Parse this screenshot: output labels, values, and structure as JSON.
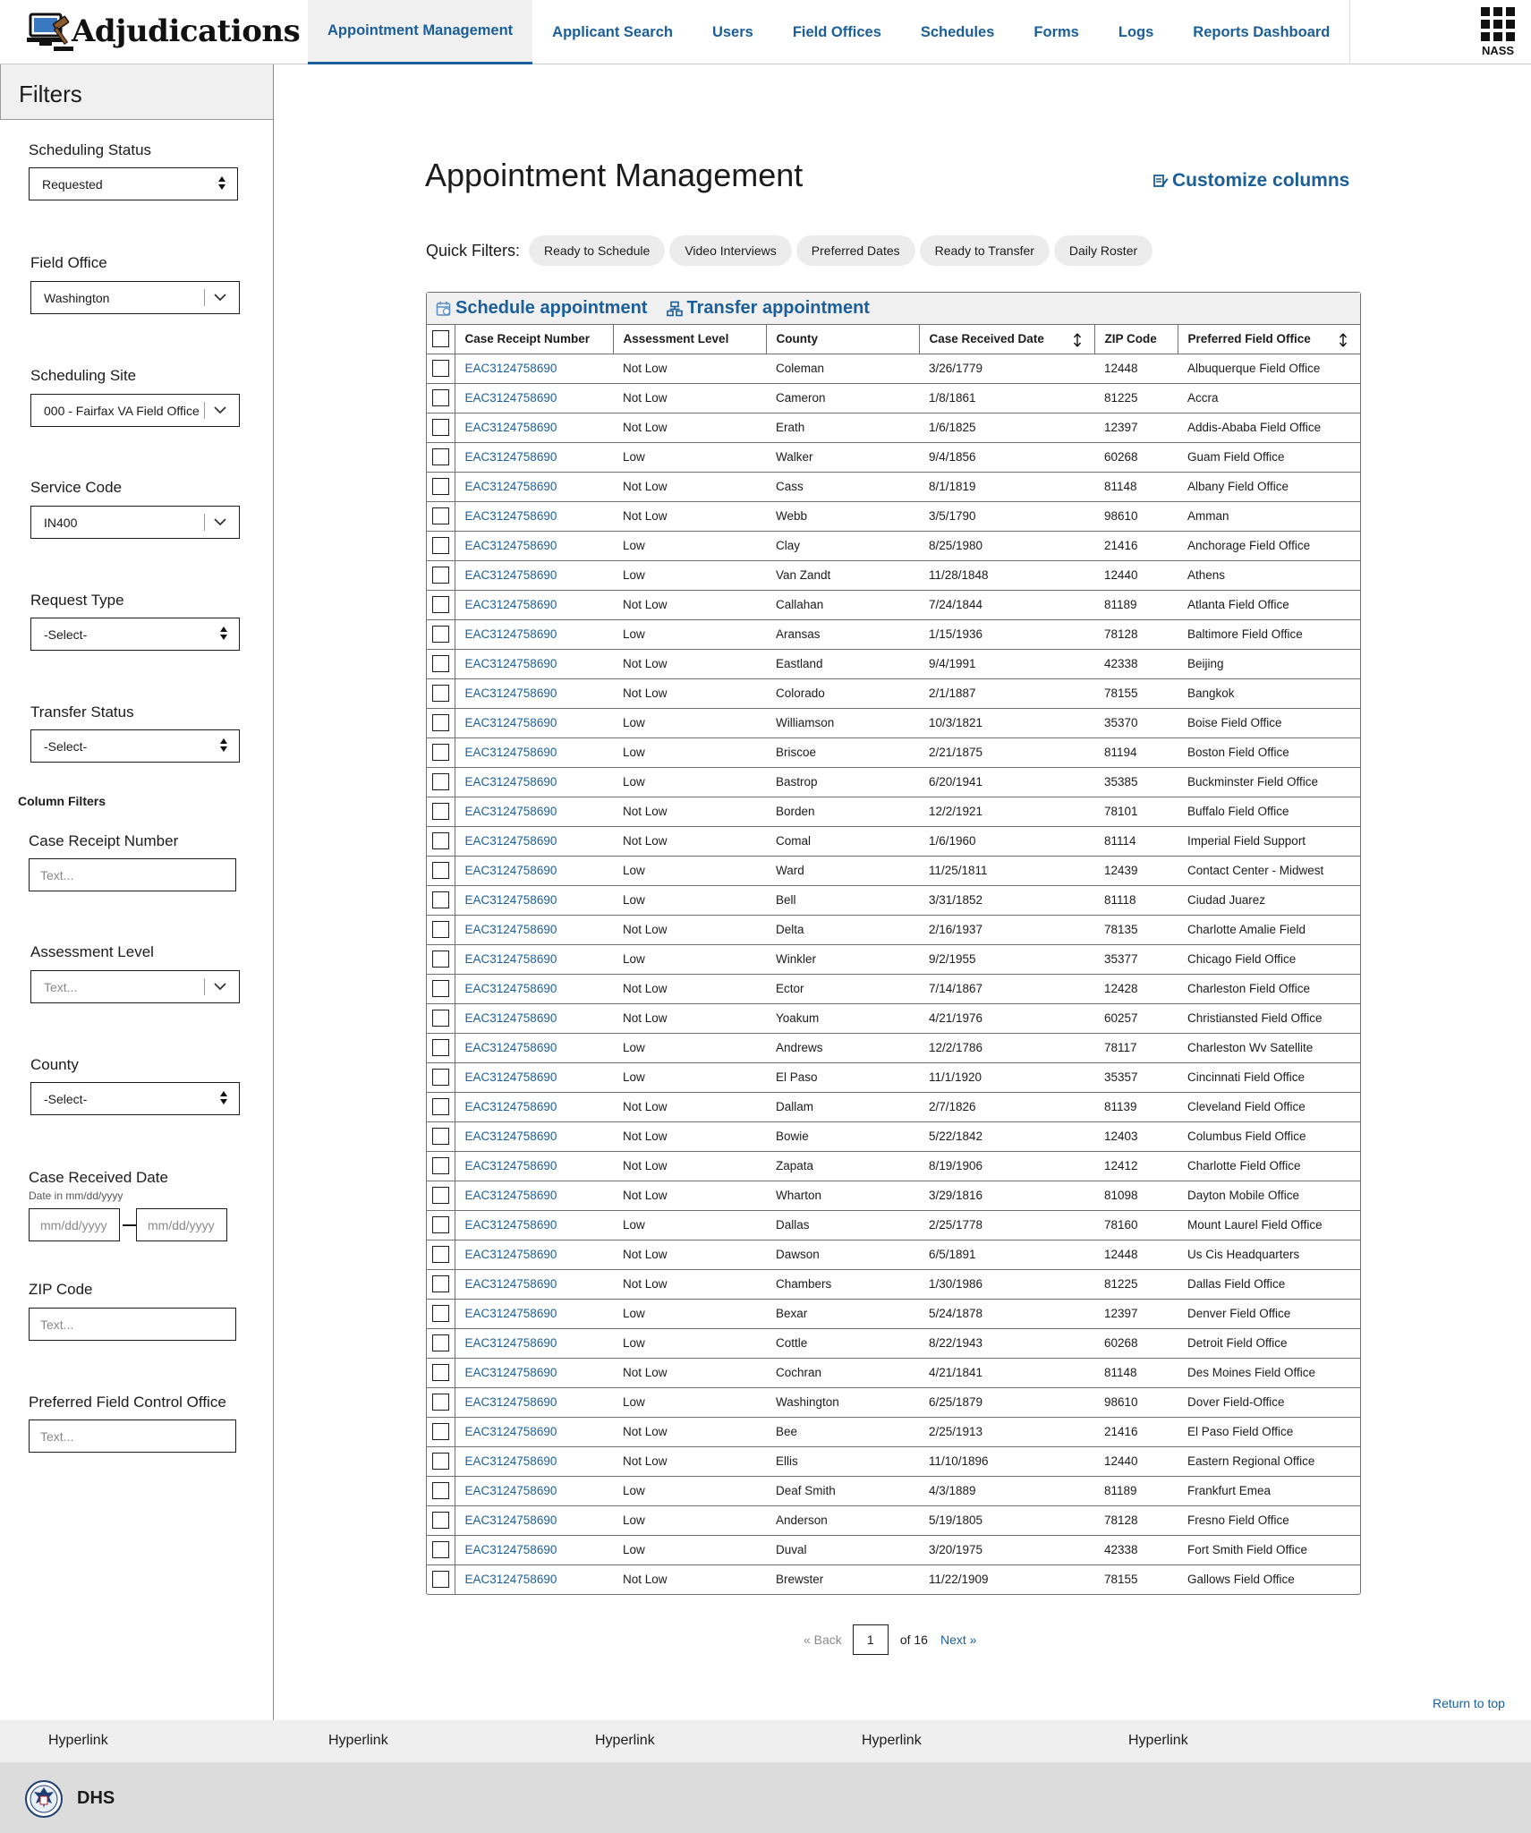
{
  "app": {
    "title": "Adjudications",
    "apps_label": "NASS"
  },
  "nav": [
    {
      "label": "Appointment Management",
      "active": true
    },
    {
      "label": "Applicant Search"
    },
    {
      "label": "Users"
    },
    {
      "label": "Field Offices"
    },
    {
      "label": "Schedules"
    },
    {
      "label": "Forms"
    },
    {
      "label": "Logs"
    },
    {
      "label": "Reports Dashboard"
    }
  ],
  "sidebar": {
    "title": "Filters",
    "scheduling_status": {
      "label": "Scheduling Status",
      "value": "Requested"
    },
    "field_office": {
      "label": "Field Office",
      "value": "Washington"
    },
    "scheduling_site": {
      "label": "Scheduling Site",
      "value": "000 - Fairfax VA Field Office"
    },
    "service_code": {
      "label": "Service Code",
      "value": "IN400"
    },
    "request_type": {
      "label": "Request Type",
      "value": "-Select-"
    },
    "transfer_status": {
      "label": "Transfer Status",
      "value": "-Select-"
    },
    "column_filters_title": "Column Filters",
    "case_receipt_number": {
      "label": "Case Receipt Number",
      "placeholder": "Text..."
    },
    "assessment_level": {
      "label": "Assessment Level",
      "placeholder": "Text..."
    },
    "county": {
      "label": "County",
      "value": "-Select-"
    },
    "case_received_date": {
      "label": "Case Received Date",
      "hint": "Date in mm/dd/yyyy",
      "from_placeholder": "mm/dd/yyyy",
      "to_placeholder": "mm/dd/yyyy"
    },
    "zip_code": {
      "label": "ZIP Code",
      "placeholder": "Text..."
    },
    "preferred_field_control_office": {
      "label": "Preferred Field Control Office",
      "placeholder": "Text..."
    }
  },
  "main": {
    "title": "Appointment Management",
    "customize_label": "Customize columns",
    "quick_filters_label": "Quick Filters:",
    "quick_filters": [
      "Ready to Schedule",
      "Video Interviews",
      "Preferred Dates",
      "Ready to Transfer",
      "Daily Roster"
    ],
    "actions": {
      "schedule": "Schedule appointment",
      "transfer": "Transfer appointment"
    },
    "columns": [
      "Case Receipt Number",
      "Assessment Level",
      "County",
      "Case Received Date",
      "ZIP Code",
      "Preferred Field Office"
    ],
    "rows": [
      [
        "EAC3124758690",
        "Not Low",
        "Coleman",
        "3/26/1779",
        "12448",
        "Albuquerque Field Office"
      ],
      [
        "EAC3124758690",
        "Not Low",
        "Cameron",
        "1/8/1861",
        "81225",
        "Accra"
      ],
      [
        "EAC3124758690",
        "Not Low",
        "Erath",
        "1/6/1825",
        "12397",
        "Addis-Ababa Field Office"
      ],
      [
        "EAC3124758690",
        "Low",
        "Walker",
        "9/4/1856",
        "60268",
        "Guam Field Office"
      ],
      [
        "EAC3124758690",
        "Not Low",
        "Cass",
        "8/1/1819",
        "81148",
        "Albany Field Office"
      ],
      [
        "EAC3124758690",
        "Not Low",
        "Webb",
        "3/5/1790",
        "98610",
        "Amman"
      ],
      [
        "EAC3124758690",
        "Low",
        "Clay",
        "8/25/1980",
        "21416",
        "Anchorage Field Office"
      ],
      [
        "EAC3124758690",
        "Low",
        "Van Zandt",
        "11/28/1848",
        "12440",
        "Athens"
      ],
      [
        "EAC3124758690",
        "Not Low",
        "Callahan",
        "7/24/1844",
        "81189",
        "Atlanta Field Office"
      ],
      [
        "EAC3124758690",
        "Low",
        "Aransas",
        "1/15/1936",
        "78128",
        "Baltimore Field Office"
      ],
      [
        "EAC3124758690",
        "Not Low",
        "Eastland",
        "9/4/1991",
        "42338",
        "Beijing"
      ],
      [
        "EAC3124758690",
        "Not Low",
        "Colorado",
        "2/1/1887",
        "78155",
        "Bangkok"
      ],
      [
        "EAC3124758690",
        "Low",
        "Williamson",
        "10/3/1821",
        "35370",
        "Boise Field Office"
      ],
      [
        "EAC3124758690",
        "Low",
        "Briscoe",
        "2/21/1875",
        "81194",
        "Boston Field Office"
      ],
      [
        "EAC3124758690",
        "Low",
        "Bastrop",
        "6/20/1941",
        "35385",
        "Buckminster Field Office"
      ],
      [
        "EAC3124758690",
        "Not Low",
        "Borden",
        "12/2/1921",
        "78101",
        "Buffalo Field Office"
      ],
      [
        "EAC3124758690",
        "Not Low",
        "Comal",
        "1/6/1960",
        "81114",
        "Imperial Field Support"
      ],
      [
        "EAC3124758690",
        "Low",
        "Ward",
        "11/25/1811",
        "12439",
        "Contact Center - Midwest"
      ],
      [
        "EAC3124758690",
        "Low",
        "Bell",
        "3/31/1852",
        "81118",
        "Ciudad Juarez"
      ],
      [
        "EAC3124758690",
        "Not Low",
        "Delta",
        "2/16/1937",
        "78135",
        "Charlotte Amalie Field"
      ],
      [
        "EAC3124758690",
        "Low",
        "Winkler",
        "9/2/1955",
        "35377",
        "Chicago Field Office"
      ],
      [
        "EAC3124758690",
        "Not Low",
        "Ector",
        "7/14/1867",
        "12428",
        "Charleston Field Office"
      ],
      [
        "EAC3124758690",
        "Not Low",
        "Yoakum",
        "4/21/1976",
        "60257",
        "Christiansted Field Office"
      ],
      [
        "EAC3124758690",
        "Low",
        "Andrews",
        "12/2/1786",
        "78117",
        "Charleston Wv Satellite"
      ],
      [
        "EAC3124758690",
        "Low",
        "El Paso",
        "11/1/1920",
        "35357",
        "Cincinnati Field Office"
      ],
      [
        "EAC3124758690",
        "Not Low",
        "Dallam",
        "2/7/1826",
        "81139",
        "Cleveland Field Office"
      ],
      [
        "EAC3124758690",
        "Not Low",
        "Bowie",
        "5/22/1842",
        "12403",
        "Columbus Field Office"
      ],
      [
        "EAC3124758690",
        "Not Low",
        "Zapata",
        "8/19/1906",
        "12412",
        "Charlotte Field Office"
      ],
      [
        "EAC3124758690",
        "Not Low",
        "Wharton",
        "3/29/1816",
        "81098",
        "Dayton Mobile Office"
      ],
      [
        "EAC3124758690",
        "Low",
        "Dallas",
        "2/25/1778",
        "78160",
        "Mount Laurel Field Office"
      ],
      [
        "EAC3124758690",
        "Not Low",
        "Dawson",
        "6/5/1891",
        "12448",
        "Us Cis Headquarters"
      ],
      [
        "EAC3124758690",
        "Not Low",
        "Chambers",
        "1/30/1986",
        "81225",
        "Dallas Field Office"
      ],
      [
        "EAC3124758690",
        "Low",
        "Bexar",
        "5/24/1878",
        "12397",
        "Denver Field Office"
      ],
      [
        "EAC3124758690",
        "Low",
        "Cottle",
        "8/22/1943",
        "60268",
        "Detroit Field Office"
      ],
      [
        "EAC3124758690",
        "Not Low",
        "Cochran",
        "4/21/1841",
        "81148",
        "Des Moines Field Office"
      ],
      [
        "EAC3124758690",
        "Low",
        "Washington",
        "6/25/1879",
        "98610",
        "Dover Field-Office"
      ],
      [
        "EAC3124758690",
        "Not Low",
        "Bee",
        "2/25/1913",
        "21416",
        "El Paso Field Office"
      ],
      [
        "EAC3124758690",
        "Not Low",
        "Ellis",
        "11/10/1896",
        "12440",
        "Eastern Regional Office"
      ],
      [
        "EAC3124758690",
        "Low",
        "Deaf Smith",
        "4/3/1889",
        "81189",
        "Frankfurt Emea"
      ],
      [
        "EAC3124758690",
        "Low",
        "Anderson",
        "5/19/1805",
        "78128",
        "Fresno Field Office"
      ],
      [
        "EAC3124758690",
        "Low",
        "Duval",
        "3/20/1975",
        "42338",
        "Fort Smith Field Office"
      ],
      [
        "EAC3124758690",
        "Not Low",
        "Brewster",
        "11/22/1909",
        "78155",
        "Gallows Field Office"
      ]
    ],
    "pagination": {
      "back": "« Back",
      "page": "1",
      "of": "of 16",
      "next": "Next »"
    },
    "return_to_top": "Return to top"
  },
  "footer": {
    "links": [
      "Hyperlink",
      "Hyperlink",
      "Hyperlink",
      "Hyperlink",
      "Hyperlink"
    ],
    "agency": "DHS"
  },
  "icons": {
    "brand": "gavel-computer-icon",
    "apps": "apps-grid-icon",
    "customize": "edit-columns-icon",
    "schedule": "calendar-icon",
    "transfer": "transfer-icon",
    "sort": "sort-icon",
    "seal": "dhs-seal-icon"
  },
  "colors": {
    "link": "#1a5e9a",
    "text": "#1b1b1b",
    "chip": "#ececec",
    "footer_top": "#efefef",
    "footer_bottom": "#dcdcdc"
  }
}
